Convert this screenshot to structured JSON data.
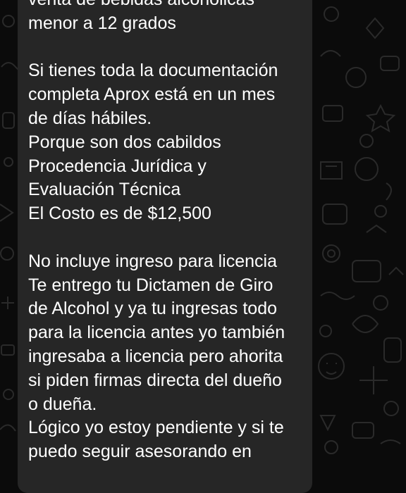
{
  "chat": {
    "background_color": "#0b0b0b",
    "bubble_color": "#262626",
    "text_color": "#ffffff",
    "doodle_color": "#2a2a2a",
    "message_lines": [
      "venta de bebidas alcohólicas",
      "menor a 12 grados",
      "",
      "Si tienes toda la documentación",
      "completa Aprox está en un mes",
      "de días hábiles.",
      "Porque son dos cabildos",
      "Procedencia Jurídica y",
      "Evaluación Técnica",
      "El Costo es de $12,500",
      "",
      "No incluye ingreso para licencia",
      "Te entrego tu Dictamen de Giro",
      "de Alcohol y ya tu ingresas todo",
      "para la licencia antes yo también",
      "ingresaba a licencia pero ahorita",
      "si piden firmas directa del dueño",
      "o dueña.",
      "Lógico yo estoy pendiente y si te",
      "puedo seguir asesorando en"
    ]
  }
}
